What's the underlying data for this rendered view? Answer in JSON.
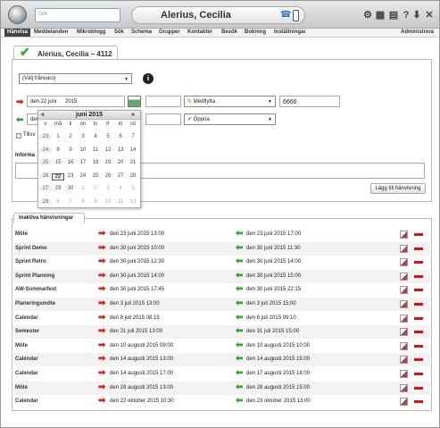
{
  "search": {
    "placeholder": "Sök"
  },
  "header": {
    "title": "Alerius, Cecilia"
  },
  "toolbar_icons": [
    "settings-icon",
    "grid-icon",
    "film-icon",
    "help-icon",
    "download-icon",
    "close-icon"
  ],
  "toolbar_glyphs": [
    "⚙",
    "▦",
    "▤",
    "?",
    "⬇",
    "✕"
  ],
  "nav": {
    "items": [
      "Hänvisa",
      "Meddelanden",
      "Mikroblogg",
      "Sök",
      "Schema",
      "Grupper",
      "Kontakter",
      "Besök",
      "Bokning",
      "Inställningar"
    ],
    "right": "Administrera"
  },
  "tab": {
    "label": "Alerius, Cecilia – 4112"
  },
  "form": {
    "absence_select": "(Välj frånvaro)",
    "start_date": "den 22 juni",
    "start_year": "2015",
    "end_date": "den",
    "accompany_select": "Medflytta",
    "number_value": "6666",
    "status_select": "Öppna",
    "checkbox_label": "Tillsv",
    "info_label": "Informa",
    "add_button": "Lägg till hänvisning"
  },
  "calendar": {
    "month": "juni 2015",
    "prev": "«",
    "next": "»",
    "headers": [
      "v",
      "må",
      "ti",
      "on",
      "to",
      "fr",
      "lö",
      "sö"
    ],
    "weeks": [
      [
        "23",
        "1",
        "2",
        "3",
        "4",
        "5",
        "6",
        "7"
      ],
      [
        "24",
        "8",
        "9",
        "10",
        "11",
        "12",
        "13",
        "14"
      ],
      [
        "25",
        "15",
        "16",
        "17",
        "18",
        "19",
        "20",
        "21"
      ],
      [
        "26",
        "22",
        "23",
        "24",
        "25",
        "26",
        "27",
        "28"
      ],
      [
        "27",
        "29",
        "30",
        "1",
        "2",
        "3",
        "4",
        "5"
      ],
      [
        "28",
        "6",
        "7",
        "8",
        "9",
        "10",
        "11",
        "12"
      ]
    ],
    "selected": "22"
  },
  "inactive": {
    "tab_label": "Inaktiva hänvisningar",
    "rows": [
      {
        "name": "Möte",
        "start": "den 23 juni 2015 13:00",
        "end": "den 23 juni 2015 17:00"
      },
      {
        "name": "Sprint Demo",
        "start": "den 30 juni 2015 10:00",
        "end": "den 30 juni 2015 11:30"
      },
      {
        "name": "Sprint Retro",
        "start": "den 30 juni 2015 12:30",
        "end": "den 30 juni 2015 14:00"
      },
      {
        "name": "Sprint Planning",
        "start": "den 30 juni 2015 14:00",
        "end": "den 30 juni 2015 15:00"
      },
      {
        "name": "AW-Sommarfest",
        "start": "den 30 juni 2015 17:45",
        "end": "den 30 juni 2015 22:15"
      },
      {
        "name": "Planeringsmöte",
        "start": "den 3 juli 2015 13:00",
        "end": "den 3 juli 2015 15:00"
      },
      {
        "name": "Calendar",
        "start": "den 8 juli 2015 08:15",
        "end": "den 8 juli 2015 09:10"
      },
      {
        "name": "Semester",
        "start": "den 31 juli 2015 13:00",
        "end": "den 31 juli 2015 15:00"
      },
      {
        "name": "Möte",
        "start": "den 10 augusti 2015 09:00",
        "end": "den 10 augusti 2015 10:00"
      },
      {
        "name": "Calendar",
        "start": "den 14 augusti 2015 13:00",
        "end": "den 14 augusti 2015 15:00"
      },
      {
        "name": "Calendar",
        "start": "den 14 augusti 2015 17:00",
        "end": "den 17 augusti 2015 18:00"
      },
      {
        "name": "Möte",
        "start": "den 28 augusti 2015 13:00",
        "end": "den 28 augusti 2015 15:00"
      },
      {
        "name": "Calendar",
        "start": "den 22 oktober 2015 10:30",
        "end": "den 23 oktober 2015 13:00"
      }
    ]
  },
  "colors": {
    "accent_green": "#3aa33a",
    "accent_red": "#dd2222",
    "nav_active": "#444444"
  }
}
